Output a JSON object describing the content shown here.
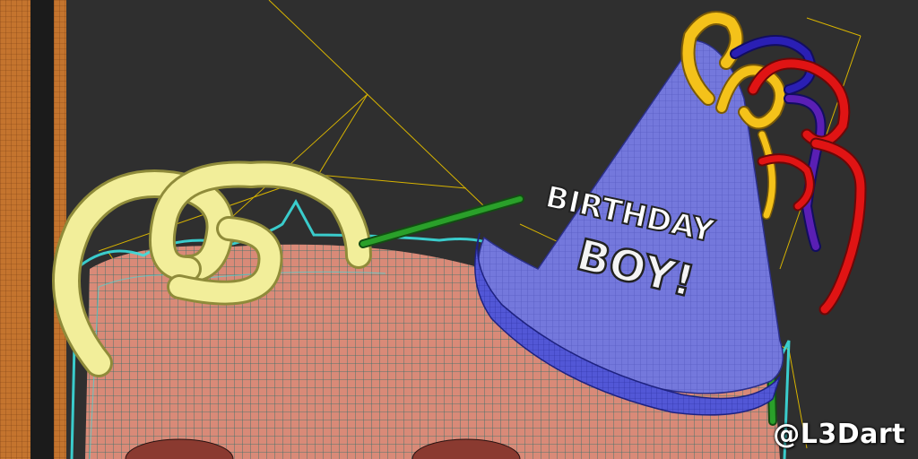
{
  "viewport": {
    "subject": "wireframe render of a character head wearing a party hat",
    "background_color": "#2f2f2f"
  },
  "hat": {
    "text_line1": "BIRTHDAY",
    "text_line2": "BOY!",
    "color": "#6b6fd6",
    "brim_color": "#4a4fd0"
  },
  "watermark": "@L3Dart",
  "colors": {
    "skin": "#d98a78",
    "hair_wire": "#3cdede",
    "curl": "#f2ee9a",
    "ribbon_yellow": "#f4c21a",
    "ribbon_red": "#e01414",
    "ribbon_blue": "#2a1fb4",
    "stick": "#2aa02a",
    "guide_lines": "#d8b400"
  }
}
